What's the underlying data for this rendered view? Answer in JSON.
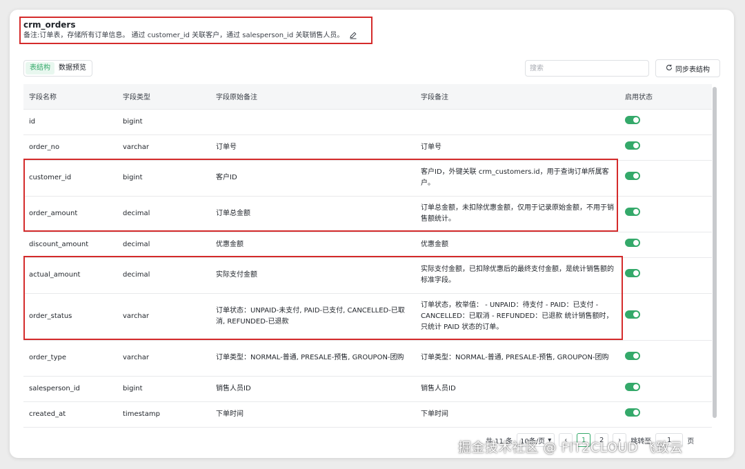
{
  "header": {
    "table_name": "crm_orders",
    "remark": "备注:订单表，存储所有订单信息。 通过 customer_id 关联客户，通过 salesperson_id 关联销售人员。"
  },
  "tabs": [
    {
      "label": "表结构",
      "active": true
    },
    {
      "label": "数据预览",
      "active": false
    }
  ],
  "search": {
    "placeholder": "搜索"
  },
  "sync_button": {
    "label": "同步表结构"
  },
  "columns": [
    "字段名称",
    "字段类型",
    "字段原始备注",
    "字段备注",
    "启用状态"
  ],
  "rows": [
    {
      "name": "id",
      "type": "bigint",
      "original_remark": "",
      "remark": "",
      "enabled": true
    },
    {
      "name": "order_no",
      "type": "varchar",
      "original_remark": "订单号",
      "remark": "订单号",
      "enabled": true
    },
    {
      "name": "customer_id",
      "type": "bigint",
      "original_remark": "客户ID",
      "remark": "客户ID，外键关联 crm_customers.id，用于查询订单所属客户。",
      "enabled": true
    },
    {
      "name": "order_amount",
      "type": "decimal",
      "original_remark": "订单总金额",
      "remark": "订单总金额，未扣除优惠金额，仅用于记录原始金额，不用于销售额统计。",
      "enabled": true
    },
    {
      "name": "discount_amount",
      "type": "decimal",
      "original_remark": "优惠金额",
      "remark": "优惠金额",
      "enabled": true
    },
    {
      "name": "actual_amount",
      "type": "decimal",
      "original_remark": "实际支付金额",
      "remark": "实际支付金额，已扣除优惠后的最终支付金额，是统计销售额的标准字段。",
      "enabled": true
    },
    {
      "name": "order_status",
      "type": "varchar",
      "original_remark": "订单状态：UNPAID-未支付, PAID-已支付, CANCELLED-已取消, REFUNDED-已退款",
      "remark": "订单状态，枚举值： - UNPAID：待支付 - PAID：已支付 - CANCELLED：已取消 - REFUNDED：已退款 统计销售额时，只统计 PAID 状态的订单。",
      "enabled": true
    },
    {
      "name": "order_type",
      "type": "varchar",
      "original_remark": "订单类型：NORMAL-普通, PRESALE-预售, GROUPON-团购",
      "remark": "订单类型：NORMAL-普通, PRESALE-预售, GROUPON-团购",
      "enabled": true
    },
    {
      "name": "salesperson_id",
      "type": "bigint",
      "original_remark": "销售人员ID",
      "remark": "销售人员ID",
      "enabled": true
    },
    {
      "name": "created_at",
      "type": "timestamp",
      "original_remark": "下单时间",
      "remark": "下单时间",
      "enabled": true
    }
  ],
  "pagination": {
    "total": "共 11 条",
    "page_size": "10条/页",
    "pages": [
      "1",
      "2"
    ],
    "current_page": "1",
    "jump_label": "跳转至",
    "jump_value": "1",
    "page_suffix": "页"
  },
  "watermark": "掘金技术社区 @ FIT2CLOUD 飞致云",
  "colors": {
    "accent": "#34a96a",
    "highlight": "#d42a2a"
  }
}
